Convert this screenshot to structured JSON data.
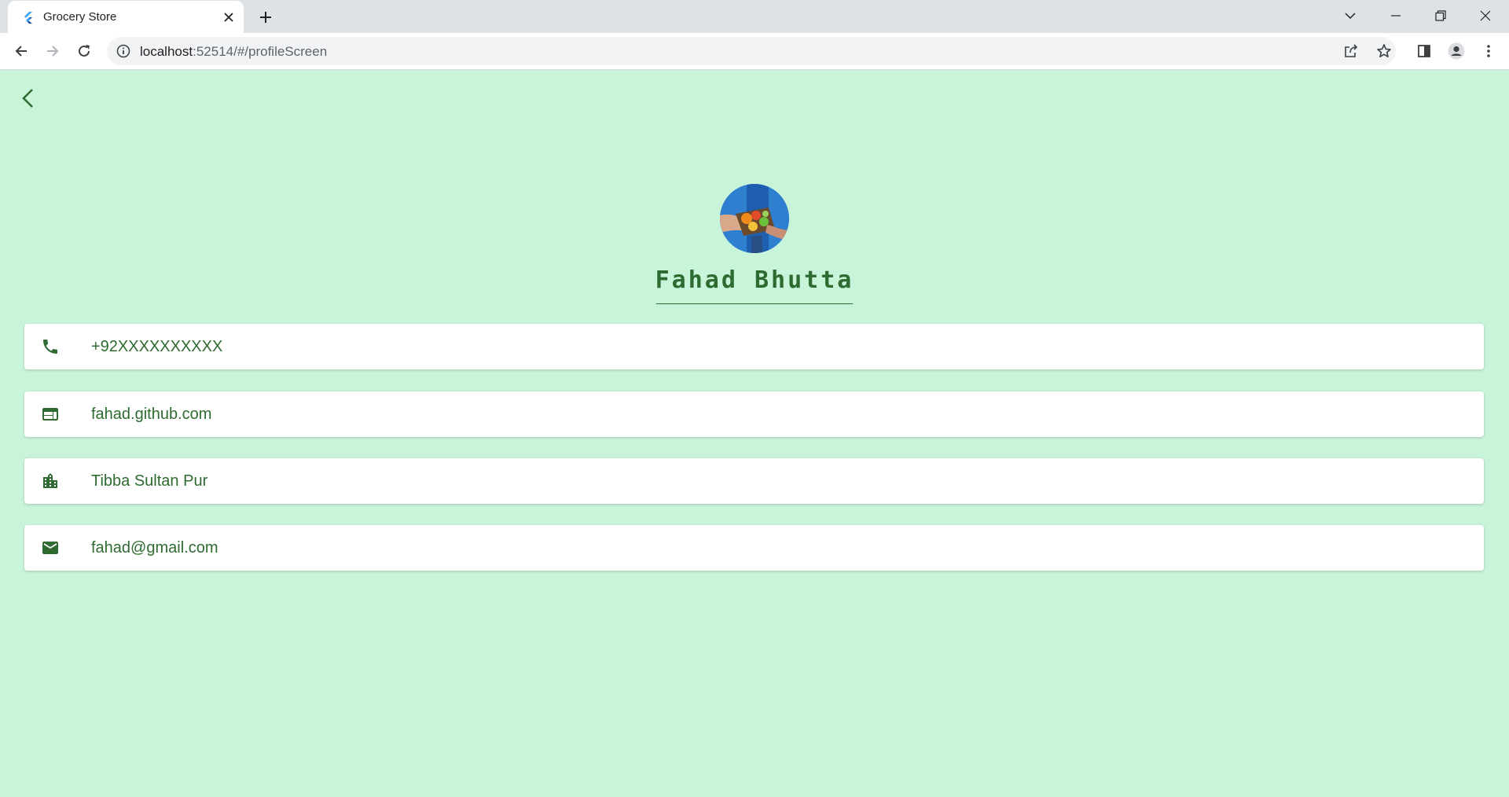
{
  "browser": {
    "tab_title": "Grocery Store",
    "url_host": "localhost",
    "url_rest": ":52514/#/profileScreen"
  },
  "profile": {
    "name": "Fahad Bhutta",
    "avatar_icon": "grocery-basket-photo"
  },
  "contacts": [
    {
      "icon": "phone-icon",
      "text": "+92XXXXXXXXXX"
    },
    {
      "icon": "web-icon",
      "text": "fahad.github.com"
    },
    {
      "icon": "location-city-icon",
      "text": "Tibba Sultan Pur"
    },
    {
      "icon": "email-icon",
      "text": "fahad@gmail.com"
    }
  ],
  "colors": {
    "background": "#c8f4da",
    "accent": "#2e6b30",
    "card": "#ffffff"
  }
}
